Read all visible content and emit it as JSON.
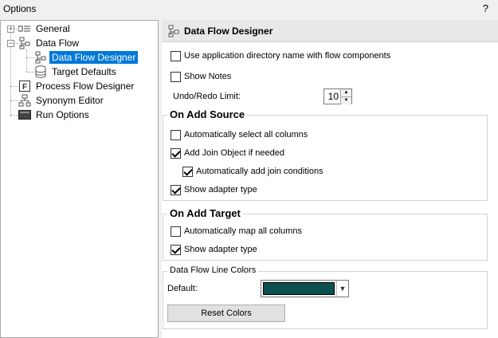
{
  "window": {
    "title": "Options",
    "help_label": "?"
  },
  "tree": {
    "items": [
      {
        "label": "General"
      },
      {
        "label": "Data Flow"
      },
      {
        "label": "Data Flow Designer"
      },
      {
        "label": "Target Defaults"
      },
      {
        "label": "Process Flow Designer"
      },
      {
        "label": "Synonym Editor"
      },
      {
        "label": "Run Options"
      }
    ],
    "selected": "Data Flow Designer"
  },
  "panel": {
    "title": "Data Flow Designer",
    "use_app_dir": {
      "label": "Use application directory name with flow components",
      "checked": false
    },
    "show_notes": {
      "label": "Show Notes",
      "checked": false
    },
    "undo_redo": {
      "label": "Undo/Redo Limit:",
      "value": "10"
    },
    "add_source": {
      "title": "On Add Source",
      "auto_select": {
        "label": "Automatically select all columns",
        "checked": false
      },
      "add_join": {
        "label": "Add Join Object if needed",
        "checked": true
      },
      "auto_join_cond": {
        "label": "Automatically add join conditions",
        "checked": true
      },
      "show_adapter": {
        "label": "Show adapter type",
        "checked": true
      }
    },
    "add_target": {
      "title": "On Add Target",
      "auto_map": {
        "label": "Automatically map all columns",
        "checked": false
      },
      "show_adapter": {
        "label": "Show adapter type",
        "checked": true
      }
    },
    "line_colors": {
      "title": "Data Flow Line Colors",
      "default_label": "Default:",
      "default_color": "#0b4f4f",
      "reset_label": "Reset Colors"
    }
  },
  "colors": {
    "selection": "#0078d7",
    "accent": "#0b4f4f"
  }
}
